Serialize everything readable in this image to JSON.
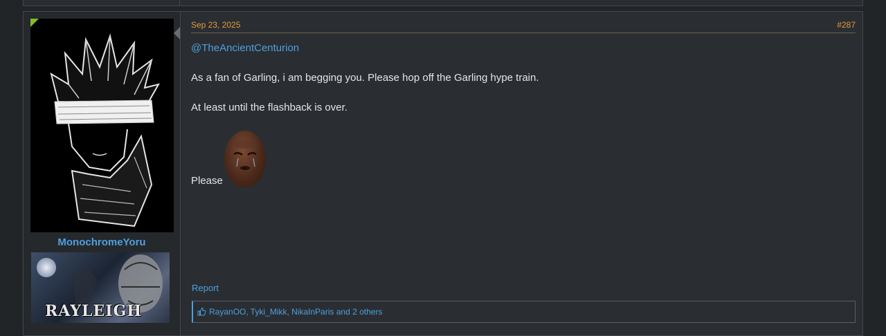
{
  "post": {
    "user": {
      "username": "MonochromeYoru",
      "banner_text": "RAYLEIGH"
    },
    "date": "Sep 23, 2025",
    "number": "#287",
    "mention": "@TheAncientCenturion",
    "paragraphs": [
      "As a fan of Garling, i am begging you. Please hop off the Garling hype train.",
      "At least until the flashback is over.",
      "Please"
    ],
    "report_label": "Report",
    "reactions_text": "RayanOO, Tyki_Mikk, NikaInParis and 2 others"
  },
  "colors": {
    "accent_link": "#4f9fe0",
    "date_orange": "#e39a3e",
    "online_green": "#7fbf2a",
    "background": "#222528"
  },
  "icons": [
    "online-flag-icon",
    "thumbs-up-icon",
    "crying-face-emoji"
  ]
}
